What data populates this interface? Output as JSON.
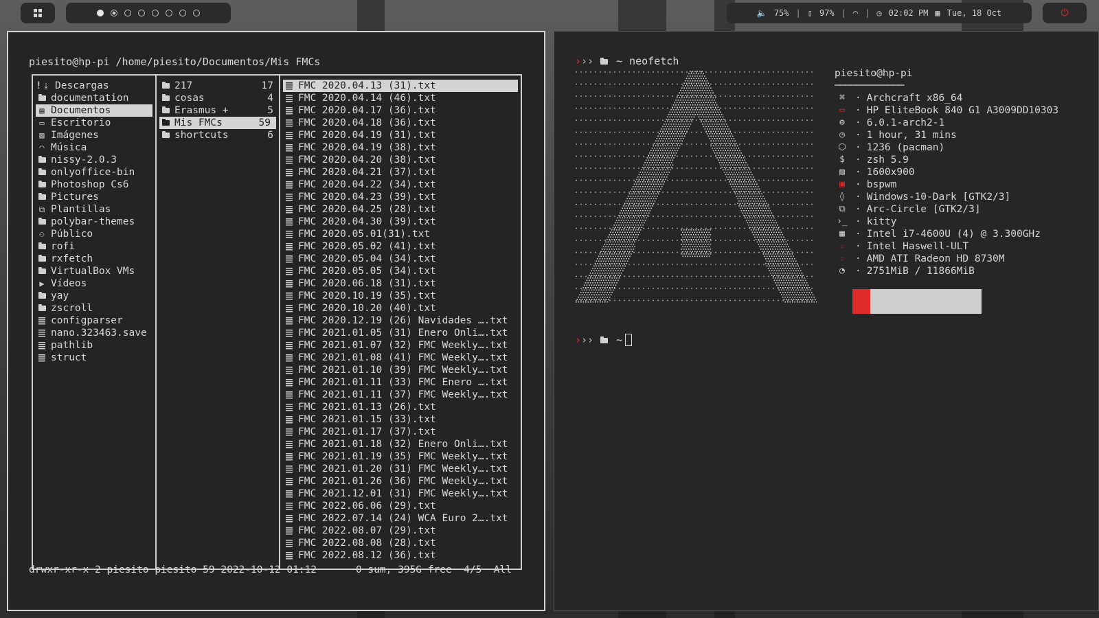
{
  "topbar": {
    "menu_icon": "grid-icon",
    "workspaces": [
      {
        "state": "active"
      },
      {
        "state": "occupied"
      },
      {
        "state": "empty"
      },
      {
        "state": "empty"
      },
      {
        "state": "empty"
      },
      {
        "state": "empty"
      },
      {
        "state": "empty"
      },
      {
        "state": "empty"
      }
    ],
    "volume": "75%",
    "battery": "97%",
    "time": "02:02 PM",
    "date": "Tue, 18 Oct",
    "separator": "|",
    "power_color": "#e02a2a"
  },
  "ranger": {
    "path": "piesito@hp-pi /home/piesito/Documentos/Mis FMCs",
    "col1": [
      {
        "icon": "download-icon",
        "name": "Descargas",
        "prefix": "!"
      },
      {
        "icon": "folder-icon",
        "name": "documentation"
      },
      {
        "icon": "document-icon",
        "name": "Documentos",
        "selected": true
      },
      {
        "icon": "monitor-icon",
        "name": "Escritorio"
      },
      {
        "icon": "image-icon",
        "name": "Imágenes"
      },
      {
        "icon": "headphones-icon",
        "name": "Música"
      },
      {
        "icon": "folder-icon",
        "name": "nissy-2.0.3"
      },
      {
        "icon": "folder-icon",
        "name": "onlyoffice-bin"
      },
      {
        "icon": "folder-icon",
        "name": "Photoshop Cs6"
      },
      {
        "icon": "folder-icon",
        "name": "Pictures"
      },
      {
        "icon": "template-icon",
        "name": "Plantillas"
      },
      {
        "icon": "folder-icon",
        "name": "polybar-themes"
      },
      {
        "icon": "users-icon",
        "name": "Público"
      },
      {
        "icon": "folder-icon",
        "name": "rofi"
      },
      {
        "icon": "folder-icon",
        "name": "rxfetch"
      },
      {
        "icon": "folder-icon",
        "name": "VirtualBox VMs"
      },
      {
        "icon": "video-icon",
        "name": "Vídeos"
      },
      {
        "icon": "folder-icon",
        "name": "yay"
      },
      {
        "icon": "folder-icon",
        "name": "zscroll"
      },
      {
        "icon": "file-icon",
        "name": "configparser"
      },
      {
        "icon": "file-icon",
        "name": "nano.323463.save"
      },
      {
        "icon": "file-icon",
        "name": "pathlib"
      },
      {
        "icon": "file-icon",
        "name": "struct"
      }
    ],
    "col2": [
      {
        "icon": "folder-icon",
        "name": "217",
        "count": "17"
      },
      {
        "icon": "folder-icon",
        "name": "cosas",
        "count": "4"
      },
      {
        "icon": "folder-icon",
        "name": "Erasmus +",
        "count": "5"
      },
      {
        "icon": "folder-icon",
        "name": "Mis FMCs",
        "count": "59",
        "selected": true
      },
      {
        "icon": "folder-icon",
        "name": "shortcuts",
        "count": "6"
      }
    ],
    "col3": [
      {
        "name": "FMC 2020.04.13 (31).txt",
        "selected": true
      },
      {
        "name": "FMC 2020.04.14 (46).txt"
      },
      {
        "name": "FMC 2020.04.17 (36).txt"
      },
      {
        "name": "FMC 2020.04.18 (36).txt"
      },
      {
        "name": "FMC 2020.04.19 (31).txt"
      },
      {
        "name": "FMC 2020.04.19 (38).txt"
      },
      {
        "name": "FMC 2020.04.20 (38).txt"
      },
      {
        "name": "FMC 2020.04.21 (37).txt"
      },
      {
        "name": "FMC 2020.04.22 (34).txt"
      },
      {
        "name": "FMC 2020.04.23 (39).txt"
      },
      {
        "name": "FMC 2020.04.25 (28).txt"
      },
      {
        "name": "FMC 2020.04.30 (39).txt"
      },
      {
        "name": "FMC 2020.05.01(31).txt"
      },
      {
        "name": "FMC 2020.05.02 (41).txt"
      },
      {
        "name": "FMC 2020.05.04 (34).txt"
      },
      {
        "name": "FMC 2020.05.05 (34).txt"
      },
      {
        "name": "FMC 2020.06.18 (31).txt"
      },
      {
        "name": "FMC 2020.10.19 (35).txt"
      },
      {
        "name": "FMC 2020.10.20 (40).txt"
      },
      {
        "name": "FMC 2020.12.19 (26) Navidades ….txt"
      },
      {
        "name": "FMC 2021.01.05 (31) Enero Onli….txt"
      },
      {
        "name": "FMC 2021.01.07 (32) FMC Weekly….txt"
      },
      {
        "name": "FMC 2021.01.08 (41) FMC Weekly….txt"
      },
      {
        "name": "FMC 2021.01.10 (39) FMC Weekly….txt"
      },
      {
        "name": "FMC 2021.01.11 (33) FMC Enero ….txt"
      },
      {
        "name": "FMC 2021.01.11 (37) FMC Weekly….txt"
      },
      {
        "name": "FMC 2021.01.13 (26).txt"
      },
      {
        "name": "FMC 2021.01.15 (33).txt"
      },
      {
        "name": "FMC 2021.01.17 (37).txt"
      },
      {
        "name": "FMC 2021.01.18 (32) Enero Onli….txt"
      },
      {
        "name": "FMC 2021.01.19 (35) FMC Weekly….txt"
      },
      {
        "name": "FMC 2021.01.20 (31) FMC Weekly….txt"
      },
      {
        "name": "FMC 2021.01.26 (36) FMC Weekly….txt"
      },
      {
        "name": "FMC 2021.12.01 (31) FMC Weekly….txt"
      },
      {
        "name": "FMC 2022.06.06 (29).txt"
      },
      {
        "name": "FMC 2022.07.14 (24) WCA Euro 2….txt"
      },
      {
        "name": "FMC 2022.08.07 (29).txt"
      },
      {
        "name": "FMC 2022.08.08 (28).txt"
      },
      {
        "name": "FMC 2022.08.12 (36).txt"
      }
    ],
    "footer_left": "drwxr-xr-x 2 piesito piesito 59 2022-10-12 01:12",
    "footer_right": "0 sum, 395G free  4/5  All"
  },
  "terminal": {
    "prompt_arrows_red": "›",
    "prompt_arrows": "››",
    "home": "~",
    "command": "neofetch",
    "user_host": "piesito@hp-pi",
    "underline": "─────────────",
    "info": [
      {
        "icon": "command-icon",
        "text": "Archcraft x86_64"
      },
      {
        "icon": "laptop-icon",
        "text": "HP EliteBook 840 G1 A3009DD10303",
        "red": true
      },
      {
        "icon": "gear-icon",
        "text": "6.0.1-arch2-1"
      },
      {
        "icon": "clock-icon",
        "text": "1 hour, 31 mins"
      },
      {
        "icon": "package-icon",
        "text": "1236 (pacman)"
      },
      {
        "icon": "dollar-icon",
        "text": "zsh 5.9"
      },
      {
        "icon": "image-icon",
        "text": "1600x900"
      },
      {
        "icon": "window-icon",
        "text": "bspwm",
        "red": true
      },
      {
        "icon": "drop-icon",
        "text": "Windows-10-Dark [GTK2/3]"
      },
      {
        "icon": "copy-icon",
        "text": "Arc-Circle [GTK2/3]"
      },
      {
        "icon": "terminal-icon",
        "text": "kitty"
      },
      {
        "icon": "cpu-icon",
        "text": "Intel i7-4600U (4) @ 3.300GHz"
      },
      {
        "icon": "star-icon",
        "text": "Intel Haswell-ULT",
        "red": true
      },
      {
        "icon": "star-icon",
        "text": "AMD ATI Radeon HD 8730M",
        "red": true
      },
      {
        "icon": "pie-icon",
        "text": "2751MiB / 11866MiB"
      }
    ],
    "info_sep": "·",
    "colors": [
      "#e02a2a",
      "#cfcfcf"
    ]
  }
}
